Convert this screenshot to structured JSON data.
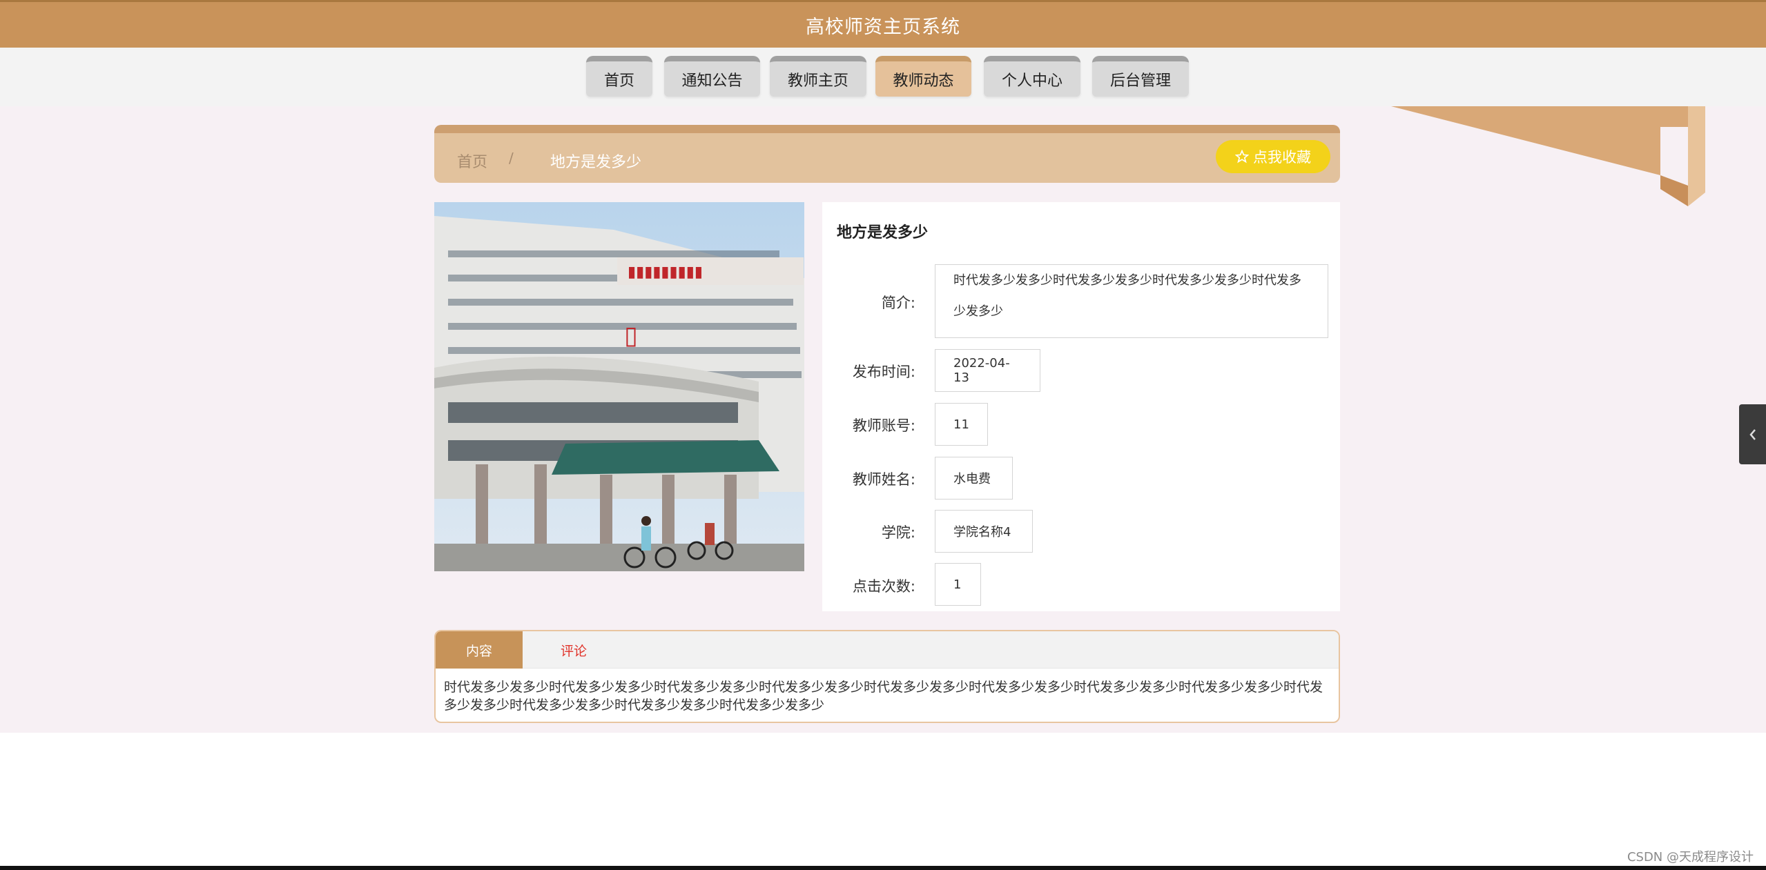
{
  "header": {
    "title": "高校师资主页系统"
  },
  "nav": [
    {
      "label": "首页",
      "active": false
    },
    {
      "label": "通知公告",
      "active": false
    },
    {
      "label": "教师主页",
      "active": false
    },
    {
      "label": "教师动态",
      "active": true
    },
    {
      "label": "个人中心",
      "active": false
    },
    {
      "label": "后台管理",
      "active": false
    }
  ],
  "breadcrumb": {
    "home": "首页",
    "separator": "/",
    "current": "地方是发多少"
  },
  "favorite_button": {
    "icon": "star-outline-icon",
    "label": "点我收藏"
  },
  "detail": {
    "title": "地方是发多少",
    "fields": [
      {
        "label": "简介:",
        "value": "时代发多少发多少时代发多少发多少时代发多少发多少时代发多少发多少"
      },
      {
        "label": "发布时间:",
        "value": "2022-04-13"
      },
      {
        "label": "教师账号:",
        "value": "11"
      },
      {
        "label": "教师姓名:",
        "value": "水电费"
      },
      {
        "label": "学院:",
        "value": "学院名称4"
      },
      {
        "label": "点击次数:",
        "value": "1"
      }
    ]
  },
  "tabs": [
    {
      "label": "内容",
      "active": true
    },
    {
      "label": "评论",
      "active": false
    }
  ],
  "content_text": "时代发多少发多少时代发多少发多少时代发多少发多少时代发多少发多少时代发多少发多少时代发多少发多少时代发多少发多少时代发多少发多少时代发多少发多少时代发多少发多少时代发多少发多少时代发多少发多少",
  "side_toggle": {
    "icon": "chevron-left-icon"
  },
  "watermark": "CSDN @天成程序设计",
  "colors": {
    "header": "#c9935a",
    "active_tab": "#c79359",
    "favorite": "#f3d21a",
    "page_bg": "#f7f0f4"
  }
}
